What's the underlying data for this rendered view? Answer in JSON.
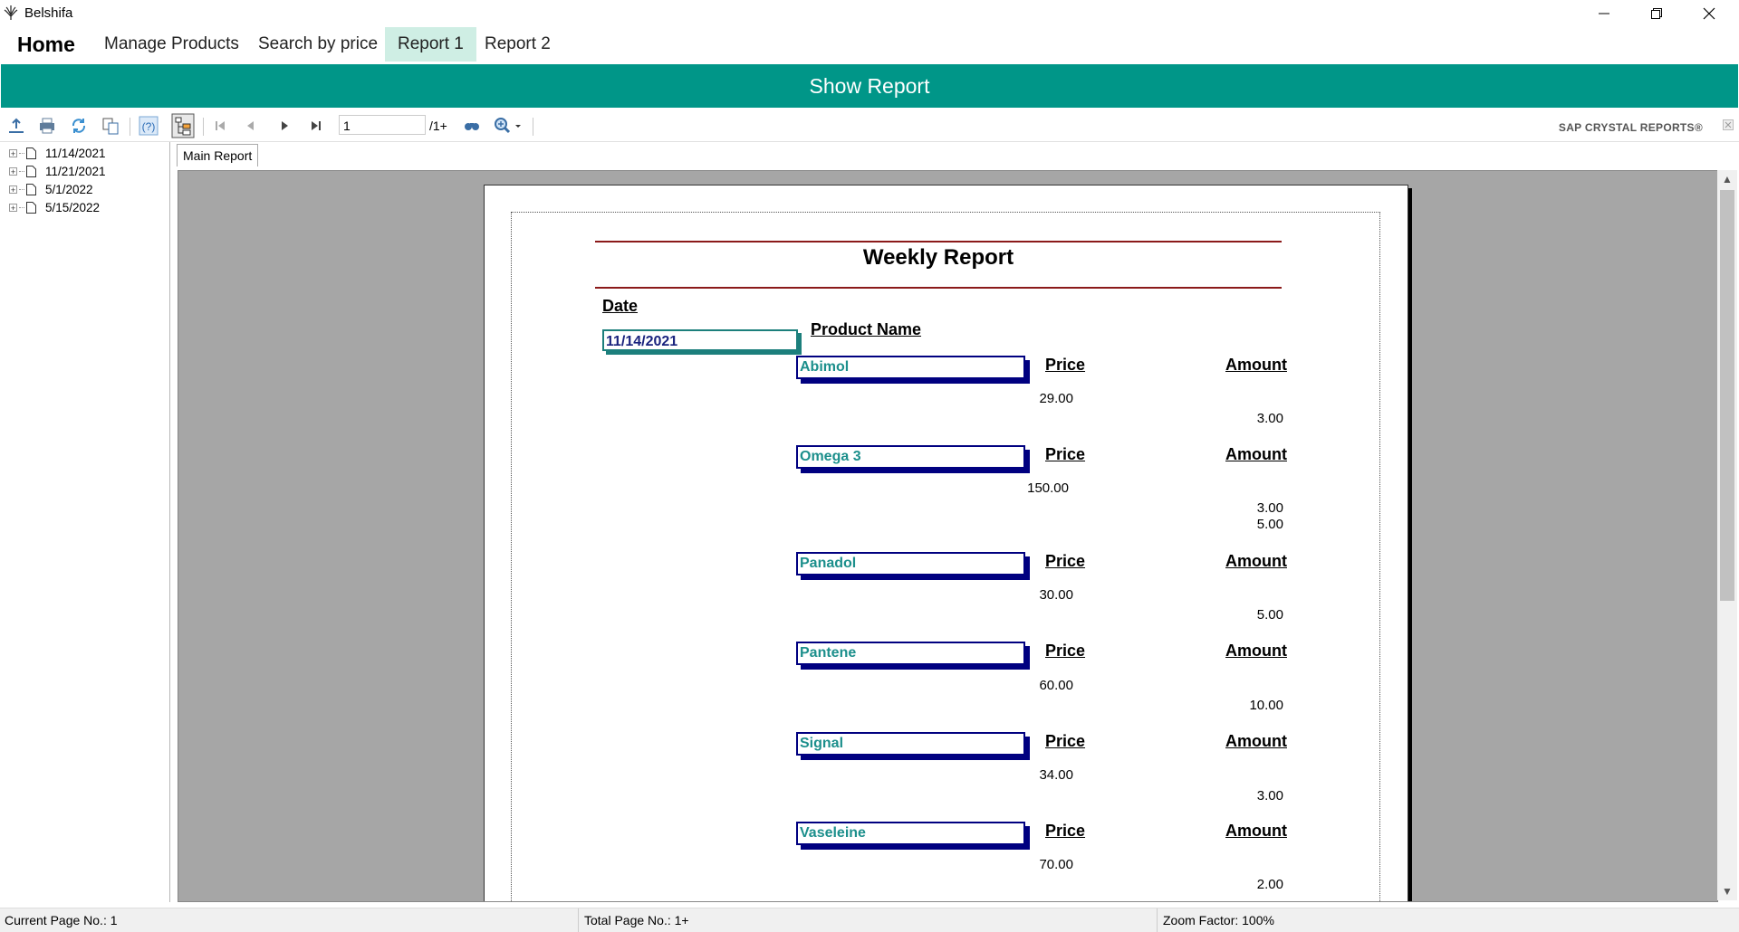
{
  "window": {
    "title": "Belshifa"
  },
  "menu": {
    "home": "Home",
    "items": [
      "Manage Products",
      "Search by price",
      "Report 1",
      "Report 2"
    ],
    "active_index": 2
  },
  "show_report_label": "Show Report",
  "toolbar": {
    "page_value": "1",
    "page_total": "/1+",
    "brand": "SAP CRYSTAL REPORTS®",
    "icons": [
      "export-icon",
      "print-icon",
      "refresh-icon",
      "copy-icon",
      "help-icon",
      "group-tree-icon",
      "first-page-icon",
      "prev-page-icon",
      "next-page-icon",
      "last-page-icon",
      "find-icon",
      "zoom-icon"
    ]
  },
  "tree": {
    "items": [
      "11/14/2021",
      "11/21/2021",
      "5/1/2022",
      "5/15/2022"
    ]
  },
  "tabs": {
    "main": "Main Report"
  },
  "report": {
    "title": "Weekly Report",
    "date_label": "Date",
    "product_name_label": "Product Name",
    "price_label": "Price",
    "amount_label": "Amount",
    "date_value": "11/14/2021",
    "products": [
      {
        "name": "Abimol",
        "price": "29.00",
        "amounts": [
          "3.00"
        ]
      },
      {
        "name": "Omega 3",
        "price": "150.00",
        "amounts": [
          "3.00",
          "5.00"
        ]
      },
      {
        "name": "Panadol",
        "price": "30.00",
        "amounts": [
          "5.00"
        ]
      },
      {
        "name": "Pantene",
        "price": "60.00",
        "amounts": [
          "10.00"
        ]
      },
      {
        "name": "Signal",
        "price": "34.00",
        "amounts": [
          "3.00"
        ]
      },
      {
        "name": "Vaseleine",
        "price": "70.00",
        "amounts": [
          "2.00"
        ]
      }
    ]
  },
  "status": {
    "current_page": "Current Page No.: 1",
    "total_page": "Total Page No.: 1+",
    "zoom": "Zoom Factor: 100%"
  },
  "colors": {
    "accent": "#009688",
    "menu_active": "#cfeee4",
    "product_border": "#000080",
    "product_text": "#1c8f8c",
    "rule": "#8b1a1a"
  }
}
